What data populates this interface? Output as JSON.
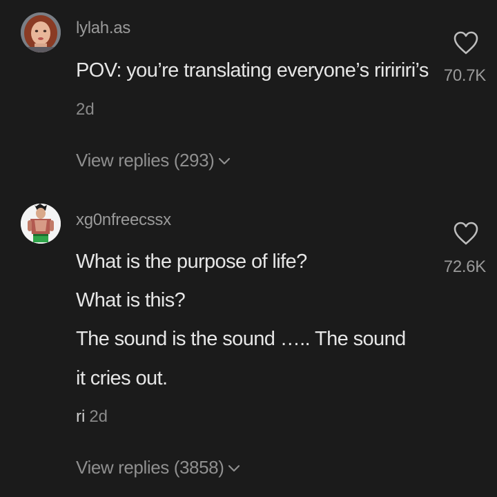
{
  "comments": [
    {
      "username": "lylah.as",
      "lines": [
        "POV: you’re translating everyone’s riririri’s"
      ],
      "time": "2d",
      "reply_tag": "",
      "likes": "70.7K",
      "view_replies": "View replies (293)",
      "avatar_icon": "avatar-photo"
    },
    {
      "username": "xg0nfreecssx",
      "lines": [
        "What is the purpose of life?",
        "What is this?",
        "The sound is the sound ….. The sound",
        "it cries out."
      ],
      "time": "2d",
      "reply_tag": "ri",
      "likes": "72.6K",
      "view_replies": "View replies (3858)",
      "avatar_icon": "avatar-anime-character"
    }
  ],
  "colors": {
    "background": "#1b1b1b",
    "primary_text": "#e6e6e6",
    "secondary_text": "#9a9a9a"
  }
}
